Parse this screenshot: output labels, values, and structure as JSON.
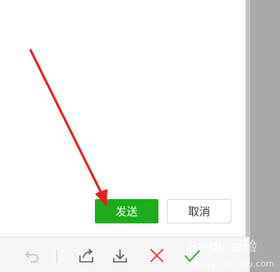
{
  "dialog": {
    "send_label": "发送",
    "cancel_label": "取消"
  },
  "toolbar": {
    "tools": [
      "undo-icon",
      "share-icon",
      "download-icon",
      "close-icon",
      "checkmark-icon"
    ]
  },
  "watermark": {
    "text": "Baidu 经验",
    "sub": "jingyan.baidu.com"
  },
  "colors": {
    "send_button": "#1aad19",
    "close_icon": "#e0393e",
    "check_icon": "#2aae34",
    "annotation_arrow": "#e8211d"
  }
}
